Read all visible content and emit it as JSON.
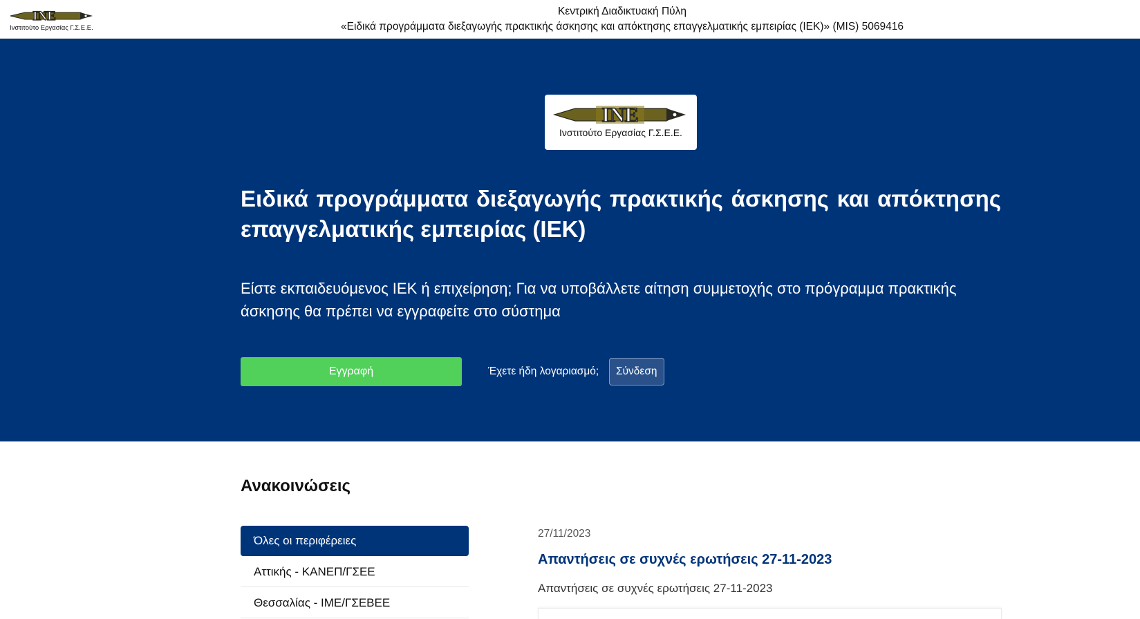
{
  "header": {
    "logo_subtitle": "Ινστιτούτο Εργασίας Γ.Σ.Ε.Ε.",
    "portal_name": "Κεντρική Διαδικτυακή Πύλη",
    "program_name": "«Ειδικά προγράμματα διεξαγωγής πρακτικής άσκησης και απόκτησης επαγγελματικής εμπειρίας (IEK)» (MIS) 5069416"
  },
  "hero": {
    "logo_letters": "INE",
    "logo_subtitle": "Ινστιτούτο Εργασίας Γ.Σ.Ε.Ε.",
    "title": "Ειδικά προγράμματα διεξαγωγής πρακτικής άσκησης και απόκτησης επαγγελματικής εμπειρίας (IEK)",
    "description": "Είστε εκπαιδευόμενος ΙΕΚ ή επιχείρηση; Για να υποβάλλετε αίτηση συμμετοχής στο πρόγραμμα πρακτικής άσκησης θα πρέπει να εγγραφείτε στο σύστημα",
    "register_label": "Εγγραφή",
    "has_account_text": "Έχετε ήδη λογαριασμό;",
    "login_label": "Σύνδεση"
  },
  "announcements": {
    "heading": "Ανακοινώσεις",
    "regions": [
      {
        "label": "Όλες οι περιφέρειες",
        "active": true
      },
      {
        "label": "Αττικής - ΚΑΝΕΠ/ΓΣΕΕ",
        "active": false
      },
      {
        "label": "Θεσσαλίας - ΙΜΕ/ΓΣΕΒΕΕ",
        "active": false
      }
    ],
    "items": [
      {
        "date": "27/11/2023",
        "title": "Απαντήσεις σε συχνές ερωτήσεις 27-11-2023",
        "summary": "Απαντήσεις σε συχνές ερωτήσεις 27-11-2023"
      }
    ]
  },
  "colors": {
    "hero_background": "#003479",
    "register_button": "#51d15a",
    "login_button": "#2a5189",
    "logo_gold": "#8b7a1e",
    "logo_dark": "#2b2a22"
  }
}
